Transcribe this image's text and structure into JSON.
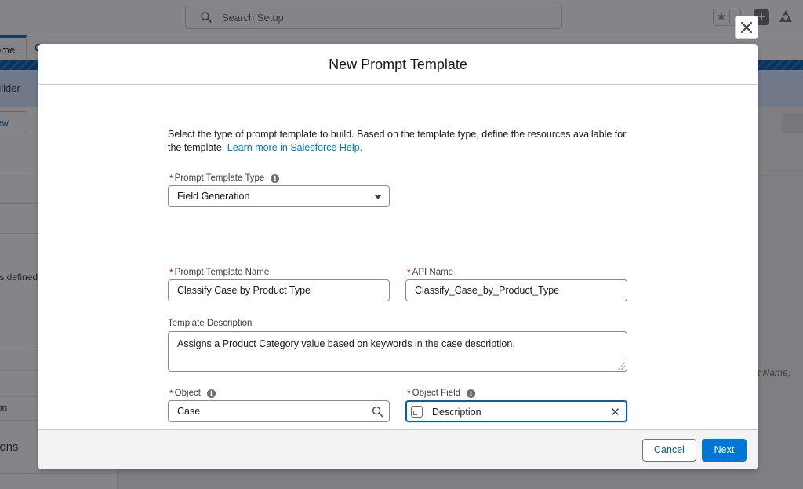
{
  "background": {
    "search_placeholder": "Search Setup",
    "tab_home": "ome",
    "tab_partial": "C",
    "band_text": "uilder",
    "view_button": "iew",
    "left_text_1": "ts defined",
    "left_text_2": "on",
    "left_text_3": "ions",
    "right_text": "t Name,"
  },
  "modal": {
    "title": "New Prompt Template",
    "intro_text": "Select the type of prompt template to build. Based on the template type, define the resources available for the template. ",
    "intro_link": "Learn more in Salesforce Help.",
    "required_marker": "*",
    "fields": {
      "type": {
        "label": "Prompt Template Type",
        "value": "Field Generation"
      },
      "name": {
        "label": "Prompt Template Name",
        "value": "Classify Case by Product Type"
      },
      "api_name": {
        "label": "API Name",
        "value": "Classify_Case_by_Product_Type"
      },
      "description": {
        "label": "Template Description",
        "value": "Assigns a Product Category value based on keywords in the case description."
      },
      "object": {
        "label": "Object",
        "value": "Case"
      },
      "object_field": {
        "label": "Object Field",
        "value": "Description"
      }
    },
    "cancel_label": "Cancel",
    "next_label": "Next",
    "close_glyph": "✕",
    "clear_glyph": "✕",
    "info_glyph": "i"
  },
  "colors": {
    "brand": "#0176d3",
    "required": "#ba0517",
    "focus": "#0b5cab"
  },
  "icons": {
    "search": "search-icon",
    "close": "close-icon",
    "info": "info-icon",
    "lookup": "search-icon",
    "field_type": "field-type-icon",
    "caret": "chevron-down-icon"
  }
}
